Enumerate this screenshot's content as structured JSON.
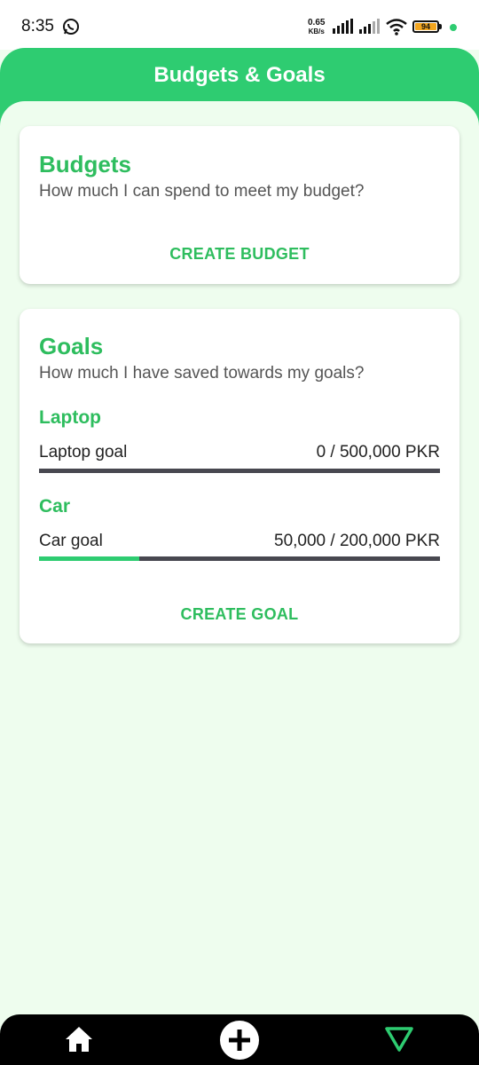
{
  "status": {
    "time": "8:35",
    "net_speed_value": "0.65",
    "net_speed_unit": "KB/s",
    "battery": "94"
  },
  "header": {
    "title": "Budgets & Goals"
  },
  "budgets": {
    "title": "Budgets",
    "subtitle": "How much I can spend to meet my budget?",
    "action": "CREATE BUDGET"
  },
  "goals": {
    "title": "Goals",
    "subtitle": "How much I have saved towards my goals?",
    "items": [
      {
        "name": "Laptop",
        "label": "Laptop goal",
        "amount": "0 / 500,000 PKR",
        "progress": 0.0
      },
      {
        "name": "Car",
        "label": "Car goal",
        "amount": "50,000 / 200,000 PKR",
        "progress": 0.25
      }
    ],
    "action": "CREATE GOAL"
  },
  "nav": {
    "home_icon": "home-icon",
    "add_icon": "add-icon",
    "filter_icon": "triangle-filter-icon"
  },
  "colors": {
    "accent": "#2ecc71",
    "text_green": "#2ebd5e",
    "background": "#eefdee"
  }
}
